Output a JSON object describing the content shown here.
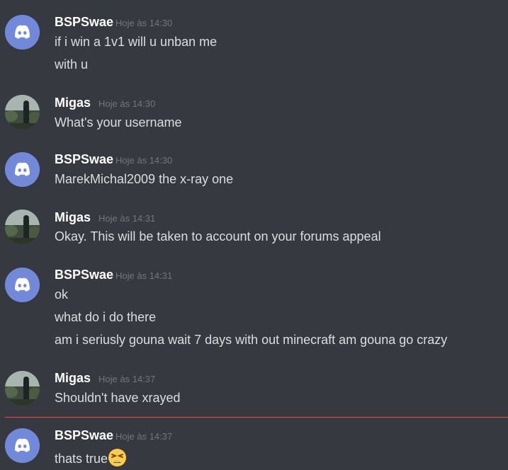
{
  "users": {
    "bsp": {
      "name": "BSPSwae",
      "avatar_icon": "discord-logo-icon",
      "avatar_color": "#7289da"
    },
    "migas": {
      "name": "Migas",
      "avatar_icon": "photo-avatar"
    }
  },
  "messages": [
    {
      "author": "BSPSwae",
      "time": "Hoje às 14:30",
      "lines": [
        "if i win a 1v1 will u unban me",
        "with u"
      ]
    },
    {
      "author": "Migas",
      "time": "Hoje às 14:30",
      "lines": [
        "What's your username"
      ]
    },
    {
      "author": "BSPSwae",
      "time": "Hoje às 14:30",
      "lines": [
        "MarekMichal2009 the x-ray one"
      ]
    },
    {
      "author": "Migas",
      "time": "Hoje às 14:31",
      "lines": [
        "Okay. This will be taken to account on your forums appeal"
      ]
    },
    {
      "author": "BSPSwae",
      "time": "Hoje às 14:31",
      "lines": [
        "ok",
        "what do i do there",
        "am i seriusly gouna wait 7 days with out minecraft am gouna go crazy"
      ]
    },
    {
      "author": "Migas",
      "time": "Hoje às 14:37",
      "lines": [
        "Shouldn't have xrayed"
      ]
    },
    {
      "author": "BSPSwae",
      "time": "Hoje às 14:37",
      "lines": [
        "thats true"
      ],
      "emoji": "tired-face-emoji"
    }
  ],
  "colors": {
    "background": "#36393f",
    "username": "#ffffff",
    "text": "#dcddde",
    "timestamp": "#72767d",
    "new_divider": "#f04747"
  }
}
